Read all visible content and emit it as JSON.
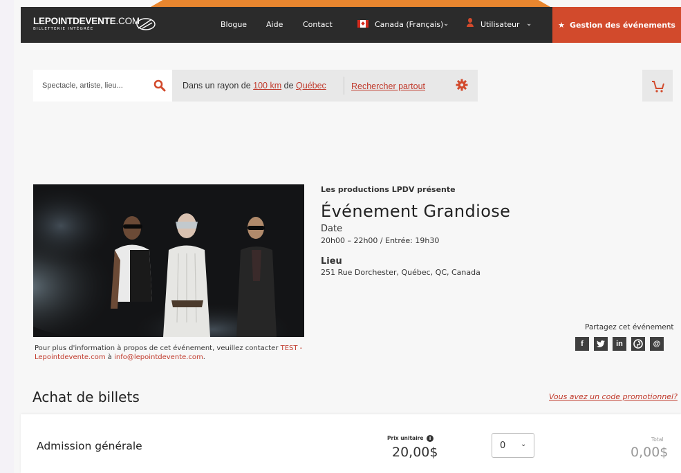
{
  "header": {
    "logo_brand_bold": "LEPOINTDEVENTE",
    "logo_brand_suffix": ".COM",
    "logo_tagline": "BILLETTERIE INTÉGRÉE",
    "nav": [
      "Blogue",
      "Aide",
      "Contact"
    ],
    "region": "Canada (Français)",
    "user": "Utilisateur",
    "events_button": "Gestion des événements"
  },
  "search": {
    "placeholder": "Spectacle, artiste, lieu...",
    "radius_prefix": "Dans un rayon de ",
    "radius_value": "100 km",
    "radius_mid": " de ",
    "city": "Québec",
    "search_everywhere": "Rechercher partout"
  },
  "event": {
    "presenter": "Les productions LPDV présente",
    "title": "Événement Grandiose",
    "date_label": "Date",
    "date_value": "20h00 – 22h00 / Entrée: 19h30",
    "venue_label": "Lieu",
    "venue_value": "251 Rue Dorchester, Québec, QC, Canada",
    "contact_prefix": "Pour plus d'information à propos de cet événement, veuillez contacter ",
    "contact_org": "TEST - Lepointdevente.com",
    "contact_mid": " à ",
    "contact_email": "info@lepointdevente.com",
    "contact_suffix": "."
  },
  "share": {
    "label": "Partagez cet événement",
    "icons": [
      "facebook-icon",
      "twitter-icon",
      "linkedin-icon",
      "pinterest-icon",
      "email-icon"
    ]
  },
  "tickets": {
    "heading": "Achat de billets",
    "promo_link": "Vous avez un code promotionnel?",
    "rows": [
      {
        "name": "Admission générale",
        "unit_price_label": "Prix unitaire",
        "unit_price": "20,00$",
        "quantity": "0",
        "total_label": "Total",
        "total": "0,00$"
      }
    ]
  },
  "colors": {
    "accent": "#d24a2c",
    "header_bg": "#2b2b2b",
    "orange_tab": "#e8862f"
  }
}
